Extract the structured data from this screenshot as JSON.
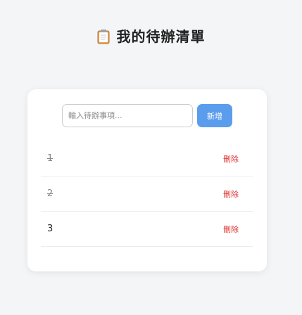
{
  "header": {
    "title": "我的待辦清單",
    "icon": "clipboard-icon"
  },
  "form": {
    "placeholder": "輸入待辦事項...",
    "value": "",
    "add_label": "新增",
    "accent": "#5b9ded"
  },
  "todos": [
    {
      "text": "1",
      "done": true,
      "delete_label": "刪除"
    },
    {
      "text": "2",
      "done": true,
      "delete_label": "刪除"
    },
    {
      "text": "3",
      "done": false,
      "delete_label": "刪除"
    }
  ],
  "colors": {
    "delete": "#e03131",
    "done_text": "#888888"
  }
}
